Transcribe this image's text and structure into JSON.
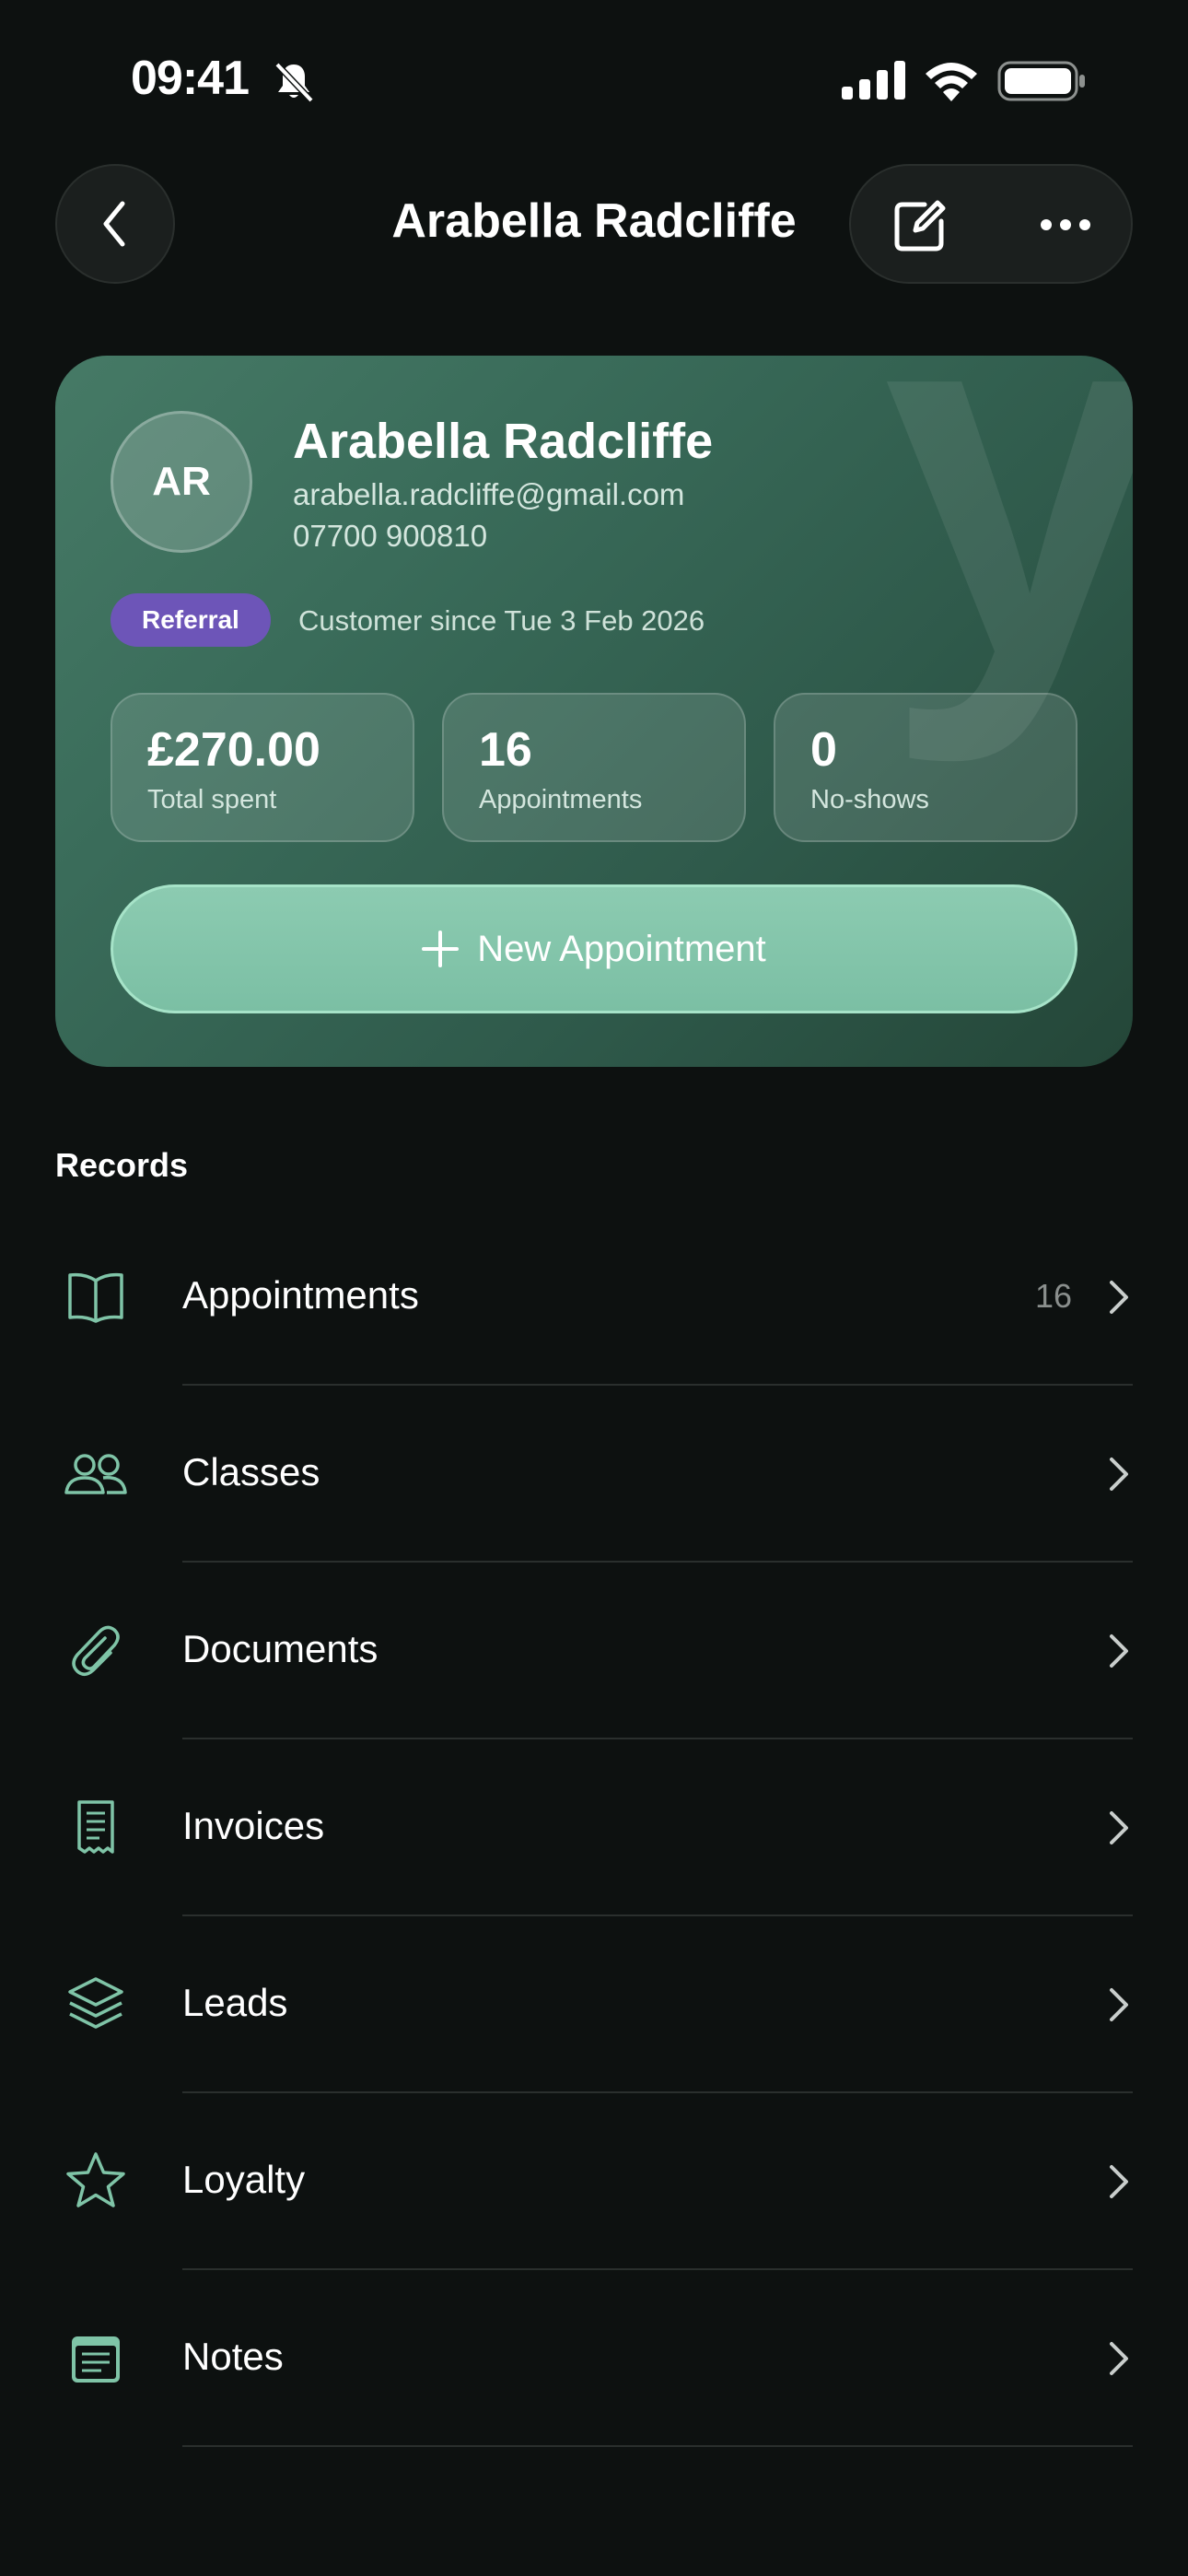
{
  "status_bar": {
    "time": "09:41"
  },
  "header": {
    "title": "Arabella Radcliffe"
  },
  "profile": {
    "initials": "AR",
    "name": "Arabella Radcliffe",
    "email": "arabella.radcliffe@gmail.com",
    "phone": "07700 900810",
    "badge": "Referral",
    "customer_since": "Customer since Tue 3 Feb 2026",
    "watermark": "y",
    "stats": [
      {
        "value": "£270.00",
        "label": "Total spent"
      },
      {
        "value": "16",
        "label": "Appointments"
      },
      {
        "value": "0",
        "label": "No-shows"
      }
    ],
    "new_appointment_label": "New Appointment"
  },
  "records": {
    "title": "Records",
    "items": [
      {
        "label": "Appointments",
        "count": "16",
        "icon": "book-icon"
      },
      {
        "label": "Classes",
        "count": "",
        "icon": "people-icon"
      },
      {
        "label": "Documents",
        "count": "",
        "icon": "paperclip-icon"
      },
      {
        "label": "Invoices",
        "count": "",
        "icon": "receipt-icon"
      },
      {
        "label": "Leads",
        "count": "",
        "icon": "layers-icon"
      },
      {
        "label": "Loyalty",
        "count": "",
        "icon": "star-icon"
      },
      {
        "label": "Notes",
        "count": "",
        "icon": "notes-icon"
      }
    ]
  },
  "colors": {
    "background": "#0d1110",
    "accent": "#7fc4a7",
    "badge": "#6d55b8",
    "card": "#3a6c5a"
  }
}
